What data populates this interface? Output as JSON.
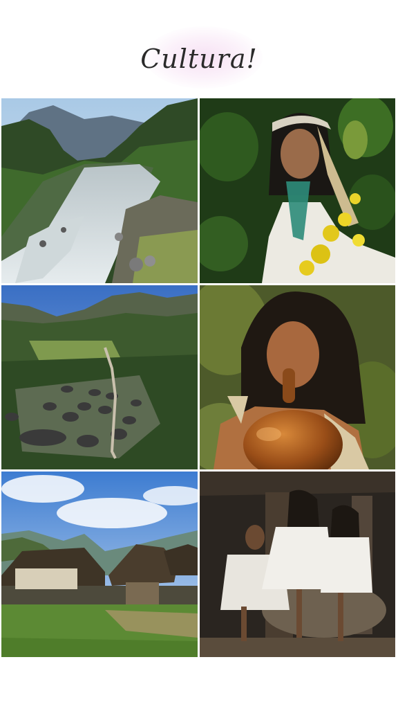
{
  "page": {
    "title": "Cultura!"
  },
  "photos": [
    {
      "icon": "river-landscape-photo"
    },
    {
      "icon": "indigenous-girl-flowers-photo"
    },
    {
      "icon": "village-aerial-photo"
    },
    {
      "icon": "girl-drinking-gourd-photo"
    },
    {
      "icon": "thatched-huts-photo"
    },
    {
      "icon": "family-portrait-photo"
    }
  ]
}
